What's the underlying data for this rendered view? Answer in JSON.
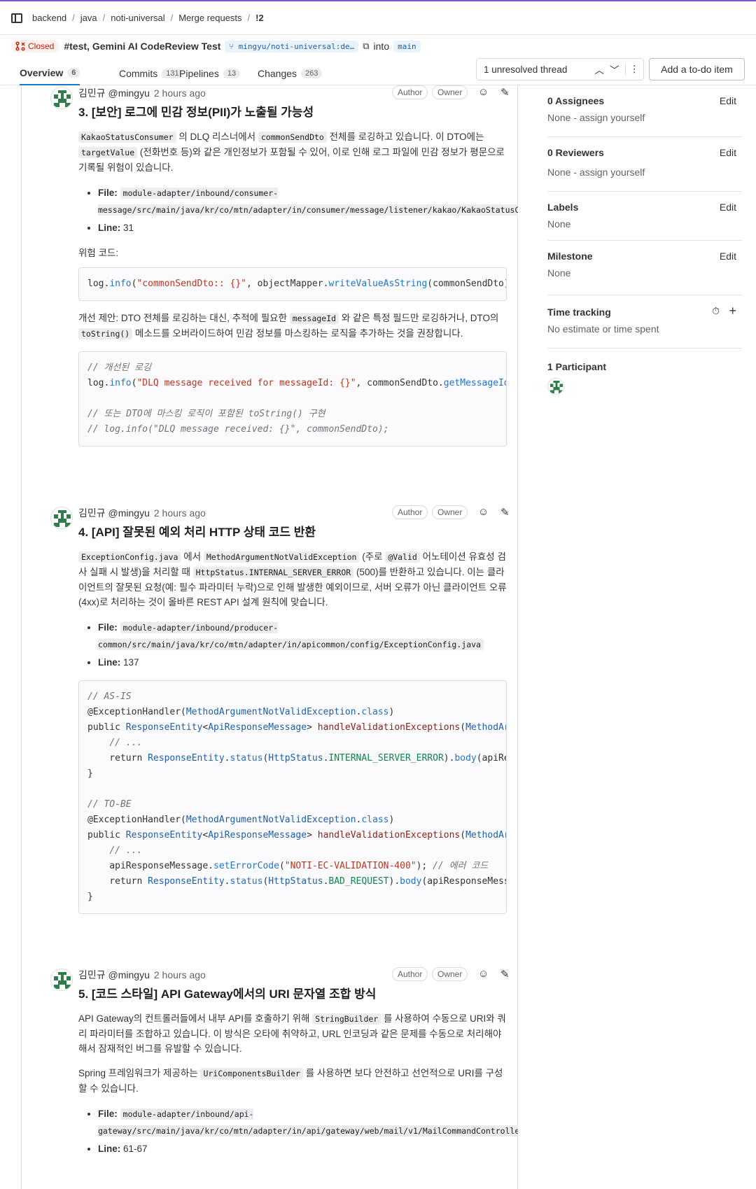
{
  "breadcrumb": [
    "backend",
    "java",
    "noti-universal",
    "Merge requests",
    "!2"
  ],
  "mr": {
    "state": "Closed",
    "title": "#test, Gemini AI CodeReview Test",
    "source_branch": "mingyu/noti-universal:de…",
    "into": "into",
    "target_branch": "main"
  },
  "tabs": [
    {
      "label": "Overview",
      "count": "6"
    },
    {
      "label": "Commits",
      "count": "131"
    },
    {
      "label": "Pipelines",
      "count": "13"
    },
    {
      "label": "Changes",
      "count": "263"
    }
  ],
  "threads": {
    "label": "1 unresolved thread"
  },
  "todo": {
    "label": "Add a to-do item"
  },
  "notes": [
    {
      "author": "김민규 @mingyu",
      "time": "2 hours ago",
      "badges": [
        "Author",
        "Owner"
      ],
      "title": "3. [보안] 로그에 민감 정보(PII)가 노출될 가능성"
    },
    {
      "author": "김민규 @mingyu",
      "time": "2 hours ago",
      "badges": [
        "Author",
        "Owner"
      ],
      "title": "4. [API] 잘못된 예외 처리 HTTP 상태 코드 반환"
    },
    {
      "author": "김민규 @mingyu",
      "time": "2 hours ago",
      "badges": [
        "Author",
        "Owner"
      ],
      "title": "5. [코드 스타일] API Gateway에서의 URI 문자열 조합 방식"
    }
  ],
  "sidebar": {
    "assignees": {
      "title": "0 Assignees",
      "value": "None - assign yourself",
      "action": "Edit"
    },
    "reviewers": {
      "title": "0 Reviewers",
      "value": "None - assign yourself",
      "action": "Edit"
    },
    "labels": {
      "title": "Labels",
      "value": "None",
      "action": "Edit"
    },
    "milestone": {
      "title": "Milestone",
      "value": "None",
      "action": "Edit"
    },
    "time": {
      "title": "Time tracking",
      "value": "No estimate or time spent"
    },
    "participants": {
      "title": "1 Participant"
    }
  },
  "colors": {
    "accent": "#1f75cb",
    "closed": "#c91c00",
    "topline": "#7b58cf"
  }
}
